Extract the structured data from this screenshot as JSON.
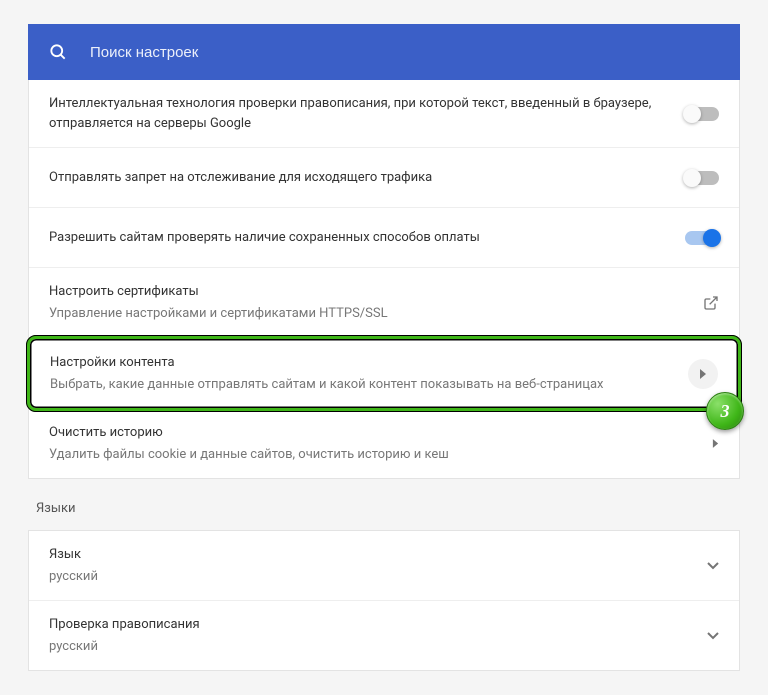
{
  "search": {
    "placeholder": "Поиск настроек"
  },
  "privacy": {
    "spellcheck": {
      "title": "Интеллектуальная технология проверки правописания, при которой текст, введенный в браузере, отправляется на серверы Google"
    },
    "dnt": {
      "title": "Отправлять запрет на отслеживание для исходящего трафика"
    },
    "payment": {
      "title": "Разрешить сайтам проверять наличие сохраненных способов оплаты"
    },
    "certs": {
      "title": "Настроить сертификаты",
      "desc": "Управление настройками и сертификатами HTTPS/SSL"
    },
    "content": {
      "title": "Настройки контента",
      "desc": "Выбрать, какие данные отправлять сайтам и какой контент показывать на веб-страницах"
    },
    "clear": {
      "title": "Очистить историю",
      "desc": "Удалить файлы cookie и данные сайтов, очистить историю и кеш"
    }
  },
  "languages": {
    "section": "Языки",
    "lang": {
      "title": "Язык",
      "value": "русский"
    },
    "spell": {
      "title": "Проверка правописания",
      "value": "русский"
    }
  },
  "annotation": {
    "number": "3"
  }
}
